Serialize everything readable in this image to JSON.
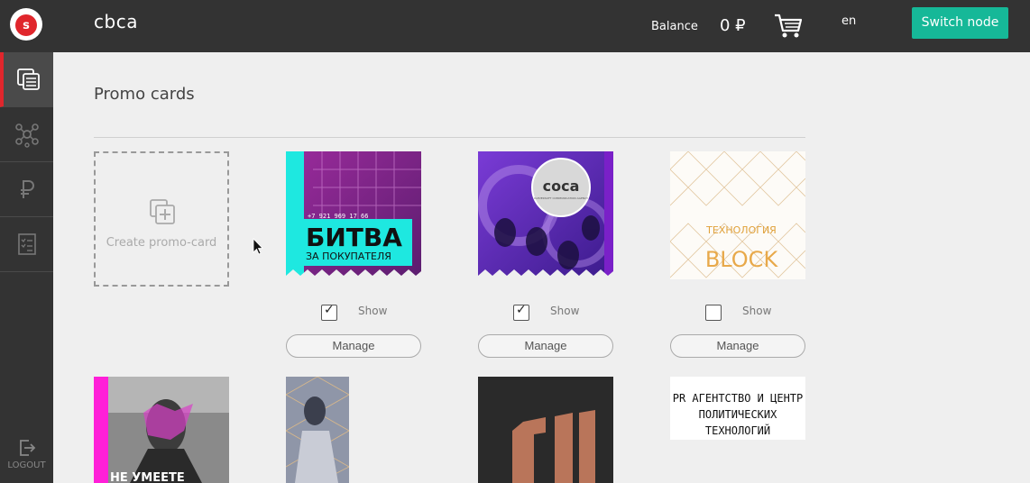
{
  "header": {
    "title": "cbca",
    "logo_letter": "s",
    "balance_label": "Balance",
    "balance_value": "0 ₽",
    "lang": "en",
    "switch_label": "Switch node"
  },
  "sidebar": {
    "items": [
      {
        "icon": "cards-icon",
        "active": true
      },
      {
        "icon": "network-icon",
        "active": false
      },
      {
        "icon": "ruble-icon",
        "active": false
      },
      {
        "icon": "checklist-icon",
        "active": false
      }
    ],
    "logout_label": "LOGOUT"
  },
  "main": {
    "title": "Promo cards",
    "create_label": "Create promo-card",
    "show_label": "Show",
    "manage_label": "Manage",
    "cards": [
      {
        "name": "battle-card",
        "headline": "БИТВА",
        "subline": "ЗА ПОКУПАТЕЛЯ",
        "phone": "+7 921 969 17 66",
        "show": true
      },
      {
        "name": "coca-card",
        "headline": "coca",
        "subline": "CLEVERSOFT COMMUNICATION AGENCY",
        "show": true
      },
      {
        "name": "block-card",
        "headline": "ТЕХНОЛОГИЯ",
        "subline": "BLOCK",
        "show": false
      }
    ],
    "row2": {
      "card1_text": "НЕ УМЕЕТЕ",
      "text_card_line1": "PR АГЕНТСТВО И ЦЕНТР",
      "text_card_line2": "ПОЛИТИЧЕСКИХ ТЕХНОЛОГИЙ"
    }
  },
  "colors": {
    "topbar": "#333333",
    "accent": "#16b898",
    "active_marker": "#e0262c"
  }
}
